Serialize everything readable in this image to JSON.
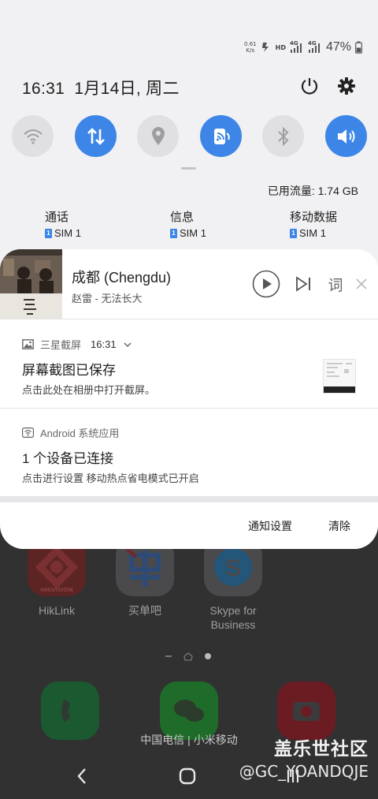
{
  "status_bar": {
    "net_speed_value": "0.61",
    "net_speed_unit": "K/s",
    "hd_label": "HD",
    "net_4g_1": "4G",
    "net_4g_2": "4G",
    "battery_percent": "47%"
  },
  "header": {
    "time": "16:31",
    "date": "1月14日, 周二"
  },
  "quick_settings": [
    {
      "name": "wifi",
      "icon": "wifi-icon",
      "active": false
    },
    {
      "name": "mobile-data",
      "icon": "data-arrows-icon",
      "active": true
    },
    {
      "name": "location",
      "icon": "location-icon",
      "active": false
    },
    {
      "name": "hotspot",
      "icon": "hotspot-icon",
      "active": true
    },
    {
      "name": "bluetooth",
      "icon": "bluetooth-icon",
      "active": false
    },
    {
      "name": "sound",
      "icon": "speaker-icon",
      "active": true
    }
  ],
  "data_usage": "已用流量: 1.74 GB",
  "sim_settings": [
    {
      "title": "通话",
      "value": "SIM 1"
    },
    {
      "title": "信息",
      "value": "SIM 1"
    },
    {
      "title": "移动数据",
      "value": "SIM 1"
    }
  ],
  "sim_badge": "1",
  "media": {
    "title": "成都 (Chengdu)",
    "artist": "赵雷 - 无法长大",
    "lyrics_label": "词"
  },
  "notifications": [
    {
      "app": "三星截屏",
      "time": "16:31",
      "title": "屏幕截图已保存",
      "body": "点击此处在相册中打开截屏。"
    },
    {
      "app": "Android 系统应用",
      "title": "1 个设备已连接",
      "body": "点击进行设置 移动热点省电模式已开启"
    }
  ],
  "footer": {
    "settings_label": "通知设置",
    "clear_label": "清除"
  },
  "home": {
    "apps": [
      {
        "label": "HikLink"
      },
      {
        "label": "买单吧"
      },
      {
        "label": "Skype for Business"
      }
    ],
    "hik_logo_text": "HIKVISION",
    "carrier": "中国电信 | 小米移动"
  },
  "watermark": {
    "line1": "盖乐世社区",
    "line2": "@GC_YOANDQJE"
  },
  "colors": {
    "accent": "#3d86e7",
    "shade_bg": "#f1f1f3",
    "card_bg": "#ffffff"
  }
}
